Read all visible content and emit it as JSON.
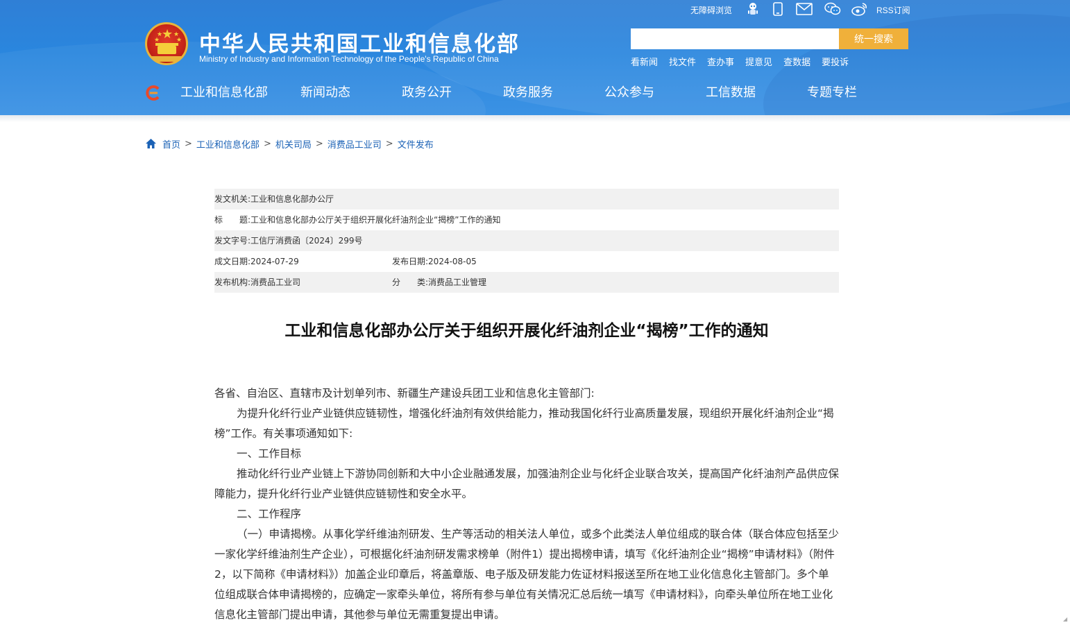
{
  "header": {
    "title": "中华人民共和国工业和信息化部",
    "subtitle": "Ministry of Industry and Information Technology of the People's Republic of China",
    "accessibility_label": "无障碍浏览",
    "rss_label": "RSS订阅",
    "search": {
      "placeholder": "",
      "value": "",
      "button_label": "统一搜索"
    },
    "quick_links": [
      "看新闻",
      "找文件",
      "查办事",
      "提意见",
      "查数据",
      "要投诉"
    ],
    "nav": [
      "工业和信息化部",
      "新闻动态",
      "政务公开",
      "政务服务",
      "公众参与",
      "工信数据",
      "专题专栏"
    ],
    "colors": {
      "header_blue": "#2a86de",
      "search_button": "#f0b03a",
      "link_blue": "#1b62b6"
    }
  },
  "breadcrumb": [
    "首页",
    "工业和信息化部",
    "机关司局",
    "消费品工业司",
    "文件发布"
  ],
  "meta": {
    "issuer_label": "发文机关:",
    "issuer": "工业和信息化部办公厅",
    "title_label": "标　　题:",
    "title": "工业和信息化部办公厅关于组织开展化纤油剂企业“揭榜”工作的通知",
    "doc_no_label": "发文字号:",
    "doc_no": "工信厅消费函〔2024〕299号",
    "created_label": "成文日期:",
    "created": "2024-07-29",
    "published_label": "发布日期:",
    "published": "2024-08-05",
    "org_label": "发布机构:",
    "org": "消费品工业司",
    "category_label": "分　　类:",
    "category": "消费品工业管理"
  },
  "article": {
    "title": "工业和信息化部办公厅关于组织开展化纤油剂企业“揭榜”工作的通知",
    "paragraphs": [
      "各省、自治区、直辖市及计划单列市、新疆生产建设兵团工业和信息化主管部门:",
      "为提升化纤行业产业链供应链韧性，增强化纤油剂有效供给能力，推动我国化纤行业高质量发展，现组织开展化纤油剂企业“揭榜”工作。有关事项通知如下:",
      "一、工作目标",
      "推动化纤行业产业链上下游协同创新和大中小企业融通发展，加强油剂企业与化纤企业联合攻关，提高国产化纤油剂产品供应保障能力，提升化纤行业产业链供应链韧性和安全水平。",
      "二、工作程序",
      "（一）申请揭榜。从事化学纤维油剂研发、生产等活动的相关法人单位，或多个此类法人单位组成的联合体（联合体应包括至少一家化学纤维油剂生产企业），可根据化纤油剂研发需求榜单（附件1）提出揭榜申请，填写《化纤油剂企业“揭榜”申请材料》（附件2，以下简称《申请材料》）加盖企业印章后，将盖章版、电子版及研发能力佐证材料报送至所在地工业化信息化主管部门。多个单位组成联合体申请揭榜的，应确定一家牵头单位，将所有参与单位有关情况汇总后统一填写《申请材料》，向牵头单位所在地工业化信息化主管部门提出申请，其他参与单位无需重复提出申请。"
    ]
  }
}
